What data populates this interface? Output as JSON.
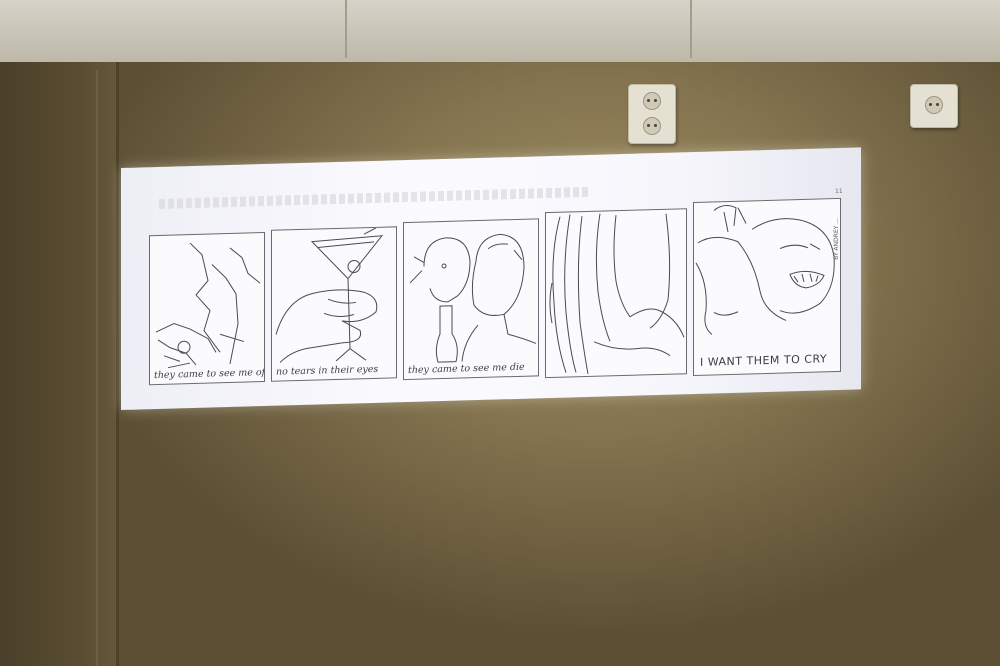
{
  "comic": {
    "panels": [
      {
        "caption": "they came to see me off"
      },
      {
        "caption": "no tears in their eyes"
      },
      {
        "caption": "they came to see me die"
      },
      {
        "caption": ""
      },
      {
        "caption": "I WANT THEM TO CRY"
      }
    ],
    "signature": "BY ANDREY ...",
    "page_number": "11"
  },
  "colors": {
    "wall": "#8c7b53",
    "projection": "#f7f7fc",
    "ink": "#3c3c46"
  }
}
